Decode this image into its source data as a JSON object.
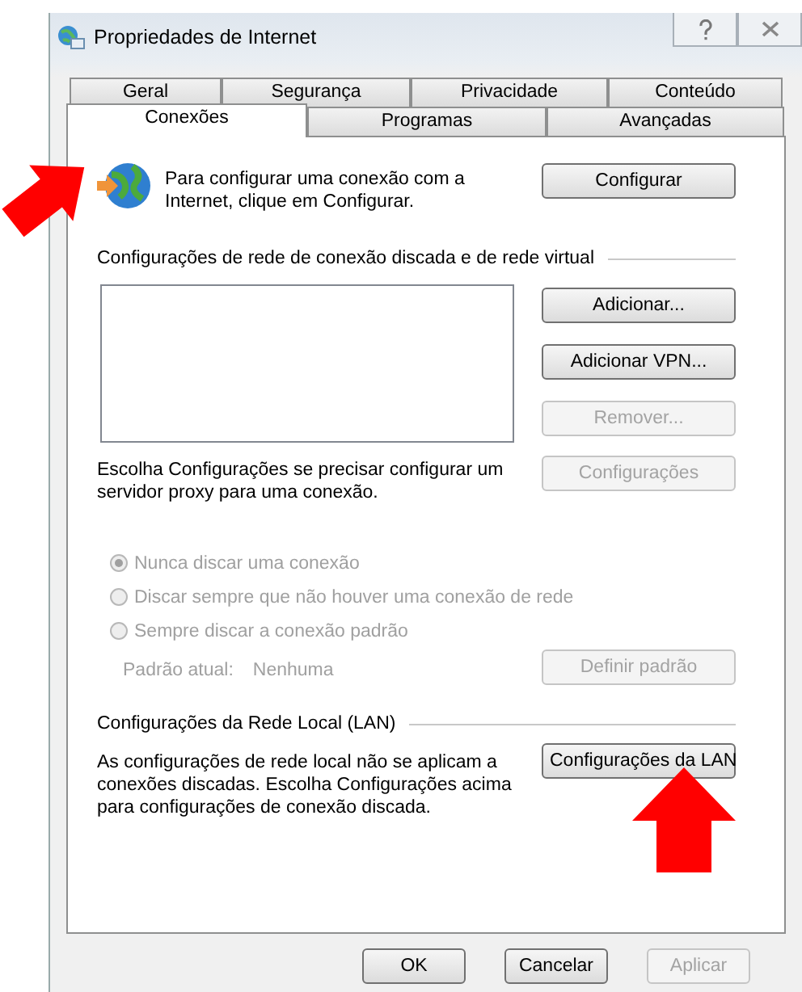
{
  "window": {
    "title": "Propriedades de Internet"
  },
  "tabs": [
    [
      {
        "label": "Geral",
        "selected": false
      },
      {
        "label": "Segurança",
        "selected": false
      },
      {
        "label": "Privacidade",
        "selected": false
      },
      {
        "label": "Conteúdo",
        "selected": false
      }
    ],
    [
      {
        "label": "Conexões",
        "selected": true
      },
      {
        "label": "Programas",
        "selected": false
      },
      {
        "label": "Avançadas",
        "selected": false
      }
    ]
  ],
  "setup": {
    "text": "Para configurar uma conexão com a Internet, clique em Configurar.",
    "button": {
      "label": "Configurar",
      "disabled": false
    }
  },
  "dialup": {
    "heading": "Configurações de rede de conexão discada e de rede virtual",
    "buttons": [
      {
        "label": "Adicionar...",
        "disabled": false
      },
      {
        "label": "Adicionar VPN...",
        "disabled": false
      },
      {
        "label": "Remover...",
        "disabled": true
      }
    ],
    "proxy_text": "Escolha Configurações se precisar configurar um servidor proxy para uma conexão.",
    "proxy_button": {
      "label": "Configurações",
      "disabled": true
    },
    "options": [
      {
        "label": "Nunca discar uma conexão",
        "selected": true,
        "disabled": true
      },
      {
        "label": "Discar sempre que não houver uma conexão de rede",
        "selected": false,
        "disabled": true
      },
      {
        "label": "Sempre discar a conexão padrão",
        "selected": false,
        "disabled": true
      }
    ],
    "default_label": "Padrão atual:",
    "default_value": "Nenhuma",
    "default_button": {
      "label": "Definir padrão",
      "disabled": true
    }
  },
  "lan": {
    "heading": "Configurações da Rede Local (LAN)",
    "text": "As configurações de rede local não se aplicam a conexões discadas. Escolha Configurações acima para configurações de conexão discada.",
    "button": {
      "label": "Configurações da LAN",
      "disabled": false
    }
  },
  "footer": [
    {
      "label": "OK",
      "disabled": false
    },
    {
      "label": "Cancelar",
      "disabled": false
    },
    {
      "label": "Aplicar",
      "disabled": true
    }
  ],
  "annotation_arrows": [
    {
      "kind": "diagonal"
    },
    {
      "kind": "up"
    }
  ]
}
